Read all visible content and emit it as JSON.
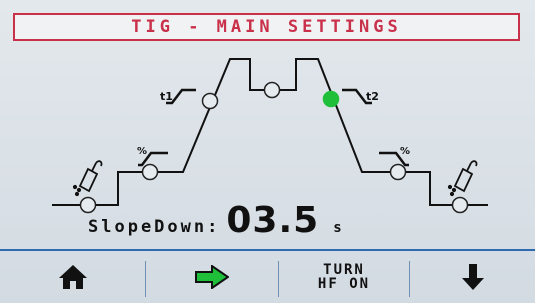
{
  "title": "TIG - MAIN SETTINGS",
  "diagram": {
    "labels": {
      "t1": "t1",
      "t2": "t2",
      "pct_left": "%",
      "pct_right": "%"
    },
    "selected_param": "SlopeDown",
    "active_color": "#1fbf3a"
  },
  "readout": {
    "label": "SlopeDown:",
    "value": "03.5",
    "unit": "s"
  },
  "toolbar": {
    "home_icon": "home-icon",
    "next_icon": "arrow-right-icon",
    "hf_line1": "TURN",
    "hf_line2": "HF ON",
    "down_icon": "arrow-down-icon"
  },
  "colors": {
    "title_red": "#c9304a",
    "accent_blue": "#2e6ab0",
    "arrow_green": "#1fbf3a"
  }
}
